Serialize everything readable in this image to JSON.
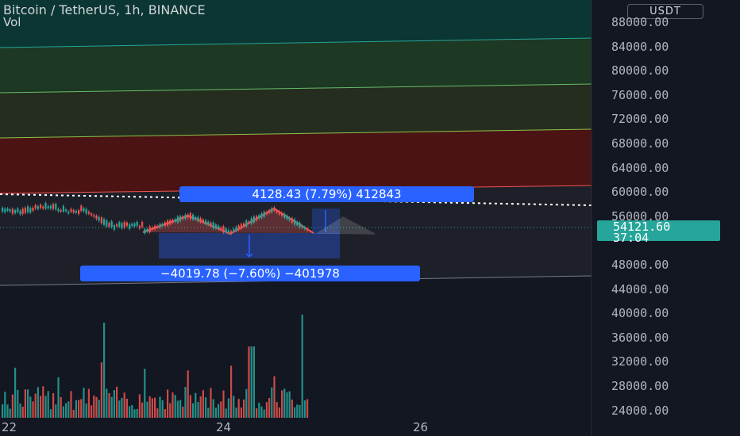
{
  "header": {
    "title": "Bitcoin / TetherUS, 1h, BINANCE",
    "volume_label": "Vol",
    "currency_button": "USDT"
  },
  "price_axis": {
    "ticks": [
      "88000.00",
      "84000.00",
      "80000.00",
      "76000.00",
      "72000.00",
      "68000.00",
      "64000.00",
      "60000.00",
      "56000.00",
      "48000.00",
      "44000.00",
      "40000.00",
      "36000.00",
      "32000.00",
      "28000.00",
      "24000.00"
    ]
  },
  "time_axis": {
    "ticks": [
      "22",
      "24",
      "26"
    ]
  },
  "last_price": {
    "value": "54121.60",
    "countdown": "37:04",
    "color": "#26a69a"
  },
  "measures": {
    "up_label": "4128.43 (7.79%) 412843",
    "down_label": "−4019.78 (−7.60%) −401978"
  },
  "colors": {
    "background": "#131722",
    "up": "#26a69a",
    "down": "#ef5350",
    "accent": "#2962ff"
  }
}
